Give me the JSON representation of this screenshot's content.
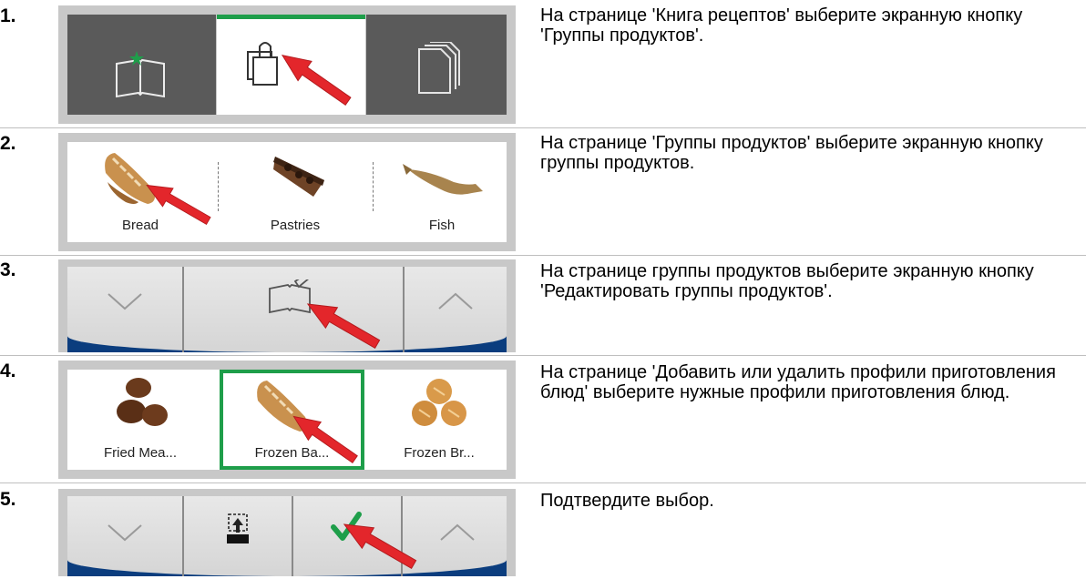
{
  "steps": [
    {
      "num": "1.",
      "text": "На странице 'Книга рецептов' выберите экранную кнопку 'Группы продуктов'."
    },
    {
      "num": "2.",
      "text": "На странице 'Группы продуктов' выберите экранную кнопку группы продуктов."
    },
    {
      "num": "3.",
      "text": "На странице группы продуктов выберите экранную кнопку 'Редактировать группы продуктов'."
    },
    {
      "num": "4.",
      "text": "На странице 'Добавить или удалить профили приготовления блюд' выберите нужные профили приготовления блюд."
    },
    {
      "num": "5.",
      "text": "Подтвердите выбор."
    }
  ],
  "groups": {
    "bread": "Bread",
    "pastries": "Pastries",
    "fish": "Fish"
  },
  "profiles": {
    "fried": "Fried Mea...",
    "frozen_ba": "Frozen Ba...",
    "frozen_br": "Frozen Br..."
  },
  "colors": {
    "accent_green": "#1e9e4a",
    "arrow_red": "#e3262b",
    "nav_blue": "#0b3d7e"
  }
}
